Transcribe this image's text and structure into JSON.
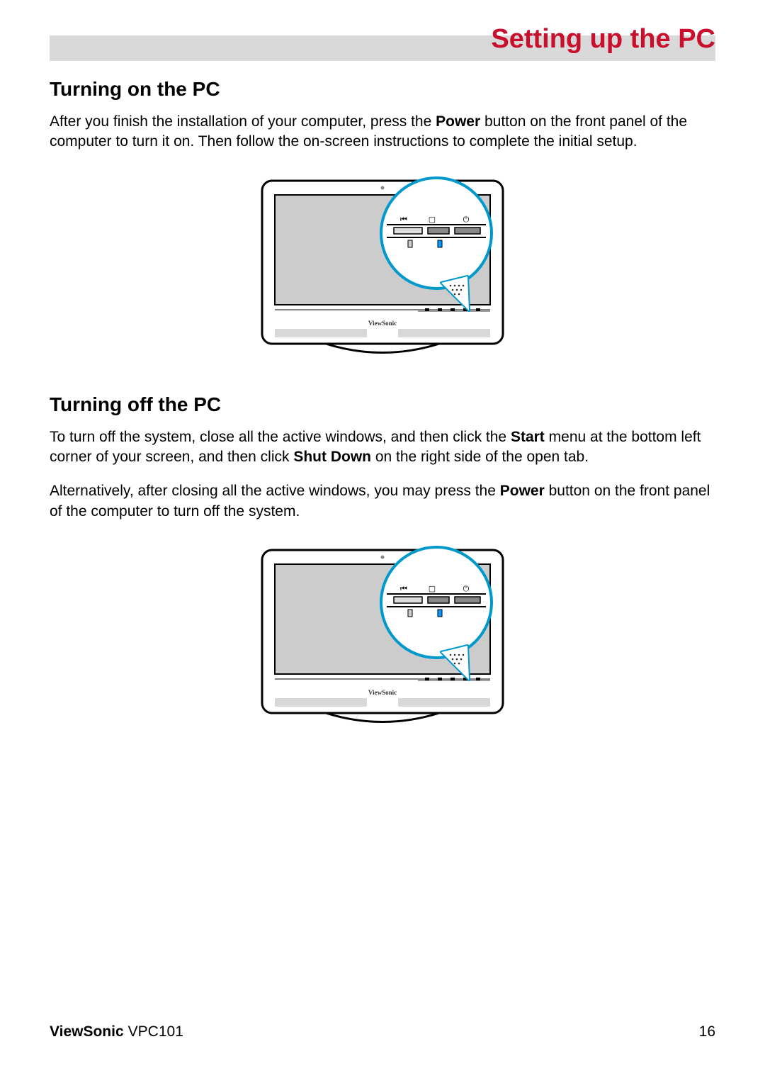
{
  "header": {
    "title": "Setting up the PC"
  },
  "section1": {
    "heading": "Turning on the PC",
    "p1_a": "After you finish the installation of your computer, press the ",
    "p1_bold": "Power",
    "p1_b": " button on the front panel of the computer to turn it on. Then follow the on-screen instructions to complete the initial setup.",
    "figure_brand": "ViewSonic"
  },
  "section2": {
    "heading": "Turning off the PC",
    "p1_a": "To turn off the system, close all the active windows, and then click the ",
    "p1_bold1": "Start",
    "p1_b": " menu at the bottom left corner of your screen, and then click ",
    "p1_bold2": "Shut Down",
    "p1_c": " on the right side of the open tab.",
    "p2_a": "Alternatively, after closing all the active windows, you may press the ",
    "p2_bold": "Power",
    "p2_b": " button on the front panel of the computer to turn off the system.",
    "figure_brand": "ViewSonic"
  },
  "footer": {
    "brand": "ViewSonic",
    "model": "VPC101",
    "page": "16"
  }
}
